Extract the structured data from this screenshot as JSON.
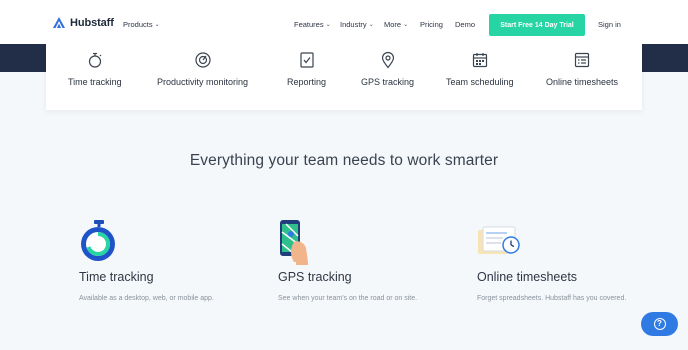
{
  "brand": {
    "name": "Hubstaff"
  },
  "nav": {
    "products": "Products",
    "features": "Features",
    "industry": "Industry",
    "more": "More",
    "pricing": "Pricing",
    "demo": "Demo",
    "cta": "Start Free 14 Day Trial",
    "signin": "Sign in"
  },
  "features_bar": [
    {
      "label": "Time tracking",
      "icon": "stopwatch-icon"
    },
    {
      "label": "Productivity monitoring",
      "icon": "gauge-icon"
    },
    {
      "label": "Reporting",
      "icon": "report-check-icon"
    },
    {
      "label": "GPS tracking",
      "icon": "map-pin-icon"
    },
    {
      "label": "Team scheduling",
      "icon": "calendar-icon"
    },
    {
      "label": "Online timesheets",
      "icon": "timesheet-icon"
    }
  ],
  "headline": "Everything your team needs to work smarter",
  "columns": [
    {
      "title": "Time tracking",
      "desc": "Available as a desktop, web, or mobile app.",
      "icon": "stopwatch-icon"
    },
    {
      "title": "GPS tracking",
      "desc": "See when your team's on the road or on site.",
      "icon": "phone-map-icon"
    },
    {
      "title": "Online timesheets",
      "desc": "Forget spreadsheets. Hubstaff has you covered.",
      "icon": "timesheet-clock-icon"
    }
  ],
  "help": {
    "glyph": "?"
  },
  "colors": {
    "accent": "#27d4a3",
    "navy": "#222d47",
    "blue": "#2f7be3",
    "background": "#f5f8fb"
  }
}
